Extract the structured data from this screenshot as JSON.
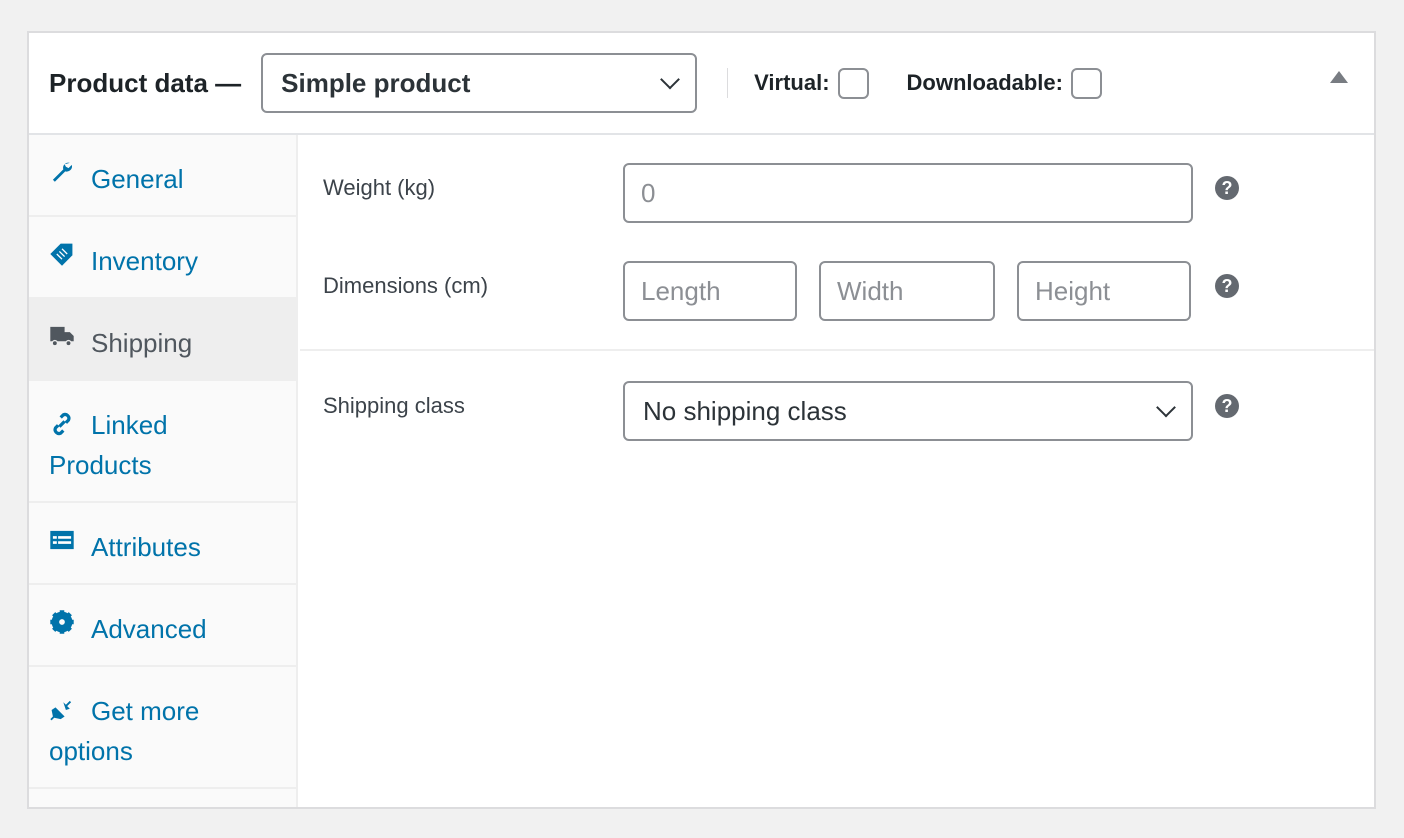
{
  "header": {
    "title": "Product data —",
    "product_type": "Simple product",
    "virtual_label": "Virtual:",
    "virtual_checked": false,
    "downloadable_label": "Downloadable:",
    "downloadable_checked": false
  },
  "sidebar": {
    "items": [
      {
        "label": "General",
        "icon": "wrench-icon"
      },
      {
        "label": "Inventory",
        "icon": "tag-icon"
      },
      {
        "label": "Shipping",
        "icon": "truck-icon",
        "active": true
      },
      {
        "label": "Linked Products",
        "icon": "link-icon"
      },
      {
        "label": "Attributes",
        "icon": "list-table-icon"
      },
      {
        "label": "Advanced",
        "icon": "gear-icon"
      },
      {
        "label": "Get more options",
        "icon": "plug-icon"
      }
    ]
  },
  "shipping": {
    "weight_label": "Weight (kg)",
    "weight_placeholder": "0",
    "dimensions_label": "Dimensions (cm)",
    "length_placeholder": "Length",
    "width_placeholder": "Width",
    "height_placeholder": "Height",
    "class_label": "Shipping class",
    "class_value": "No shipping class",
    "help": "?"
  },
  "colors": {
    "link": "#0073aa",
    "active_text": "#50575e"
  }
}
